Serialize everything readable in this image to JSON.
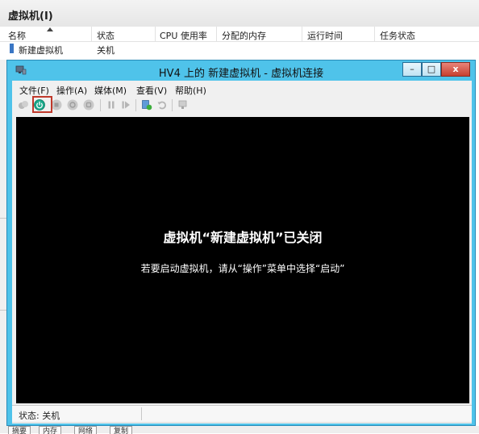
{
  "manager": {
    "panel_title": "虚拟机(I)",
    "columns": [
      "名称",
      "状态",
      "CPU 使用率",
      "分配的内存",
      "运行时间",
      "任务状态"
    ],
    "row": {
      "name": "新建虚拟机",
      "state": "关机"
    },
    "bottom_tabs": [
      "摘要",
      "内存",
      "网络",
      "复制"
    ]
  },
  "window": {
    "title": "HV4 上的 新建虚拟机 - 虚拟机连接",
    "controls": {
      "minimize": "–",
      "maximize": "□",
      "close": "x"
    },
    "menus": [
      "文件(F)",
      "操作(A)",
      "媒体(M)",
      "查看(V)",
      "帮助(H)"
    ],
    "toolbar_icons": [
      "ctrl-alt-del-icon",
      "start-icon",
      "turn-off-icon",
      "shutdown-icon",
      "save-icon",
      "pause-icon",
      "reset-icon",
      "snapshot-icon",
      "revert-icon",
      "enhanced-session-icon"
    ],
    "screen": {
      "title": "虚拟机“新建虚拟机”已关闭",
      "message": "若要启动虚拟机，请从“操作”菜单中选择“启动”"
    },
    "status": "状态: 关机"
  },
  "colors": {
    "window_frame": "#4fc3ea",
    "start_button": "#1aa88a",
    "highlight": "#c0392b",
    "screen_bg": "#000000"
  }
}
